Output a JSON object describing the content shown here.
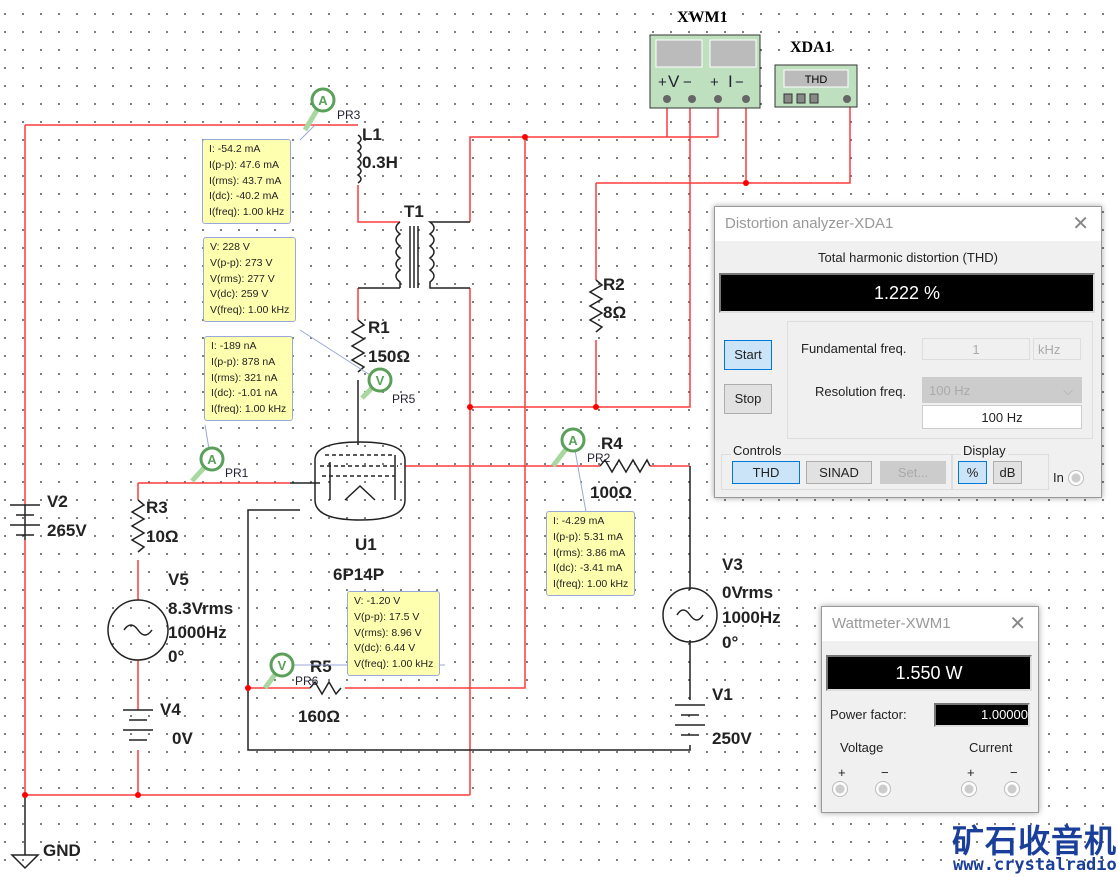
{
  "colors": {
    "wire_active": "#ff3b3b",
    "wire": "#222222",
    "probe_green": "#5aa05a",
    "instrument_green": "#bfe0bf",
    "probe_box": "#ffffb0"
  },
  "components": {
    "L1": {
      "name": "L1",
      "value": "0.3H"
    },
    "T1": {
      "name": "T1"
    },
    "R1": {
      "name": "R1",
      "value": "150Ω"
    },
    "R2": {
      "name": "R2",
      "value": "8Ω"
    },
    "R3": {
      "name": "R3",
      "value": "10Ω"
    },
    "R4": {
      "name": "R4",
      "value": "100Ω"
    },
    "R5": {
      "name": "R5",
      "value": "160Ω"
    },
    "U1": {
      "name": "U1",
      "value": "6P14P"
    },
    "V1": {
      "name": "V1",
      "value": "250V"
    },
    "V2": {
      "name": "V2",
      "value": "265V"
    },
    "V3": {
      "name": "V3",
      "lines": [
        "0Vrms",
        "1000Hz",
        "0°"
      ]
    },
    "V4": {
      "name": "V4",
      "value": "0V"
    },
    "V5": {
      "name": "V5",
      "lines": [
        "8.3Vrms",
        "1000Hz",
        "0°"
      ]
    },
    "GND": {
      "name": "GND"
    },
    "XWM1": {
      "name": "XWM1",
      "v_label": "V",
      "i_label": "I"
    },
    "XDA1": {
      "name": "XDA1",
      "display": "THD"
    }
  },
  "probes": {
    "PR3": {
      "name": "PR3",
      "type": "A",
      "lines": [
        "I: -54.2 mA",
        "I(p-p): 47.6 mA",
        "I(rms): 43.7 mA",
        "I(dc): -40.2 mA",
        "I(freq): 1.00 kHz"
      ]
    },
    "PR5": {
      "name": "PR5",
      "type": "V",
      "lines": [
        "V: 228 V",
        "V(p-p): 273 V",
        "V(rms): 277 V",
        "V(dc): 259 V",
        "V(freq): 1.00 kHz"
      ]
    },
    "PR1": {
      "name": "PR1",
      "type": "A",
      "lines": [
        "I: -189 nA",
        "I(p-p): 878 nA",
        "I(rms): 321 nA",
        "I(dc): -1.01 nA",
        "I(freq): 1.00 kHz"
      ]
    },
    "PR2": {
      "name": "PR2",
      "type": "A",
      "lines": [
        "I: -4.29 mA",
        "I(p-p): 5.31 mA",
        "I(rms): 3.86 mA",
        "I(dc): -3.41 mA",
        "I(freq): 1.00 kHz"
      ]
    },
    "PR6": {
      "name": "PR6",
      "type": "V",
      "lines": [
        "V: -1.20 V",
        "V(p-p): 17.5 V",
        "V(rms): 8.96 V",
        "V(dc): 6.44 V",
        "V(freq): 1.00 kHz"
      ]
    }
  },
  "distortion": {
    "title": "Distortion analyzer-XDA1",
    "heading": "Total harmonic distortion (THD)",
    "value": "1.222 %",
    "start": "Start",
    "stop": "Stop",
    "fund_label": "Fundamental freq.",
    "fund_value": "1",
    "fund_unit": "kHz",
    "res_label": "Resolution freq.",
    "res_select": "100 Hz",
    "res_value": "100 Hz",
    "controls_label": "Controls",
    "thd": "THD",
    "sinad": "SINAD",
    "set": "Set...",
    "display_label": "Display",
    "percent": "%",
    "db": "dB",
    "in": "In"
  },
  "wattmeter": {
    "title": "Wattmeter-XWM1",
    "value": "1.550 W",
    "pf_label": "Power factor:",
    "pf_value": "1.00000",
    "voltage": "Voltage",
    "current": "Current",
    "plus": "+",
    "minus": "−"
  },
  "watermark": {
    "cn": "矿石收音机",
    "url": "www.crystalradio.cn"
  }
}
